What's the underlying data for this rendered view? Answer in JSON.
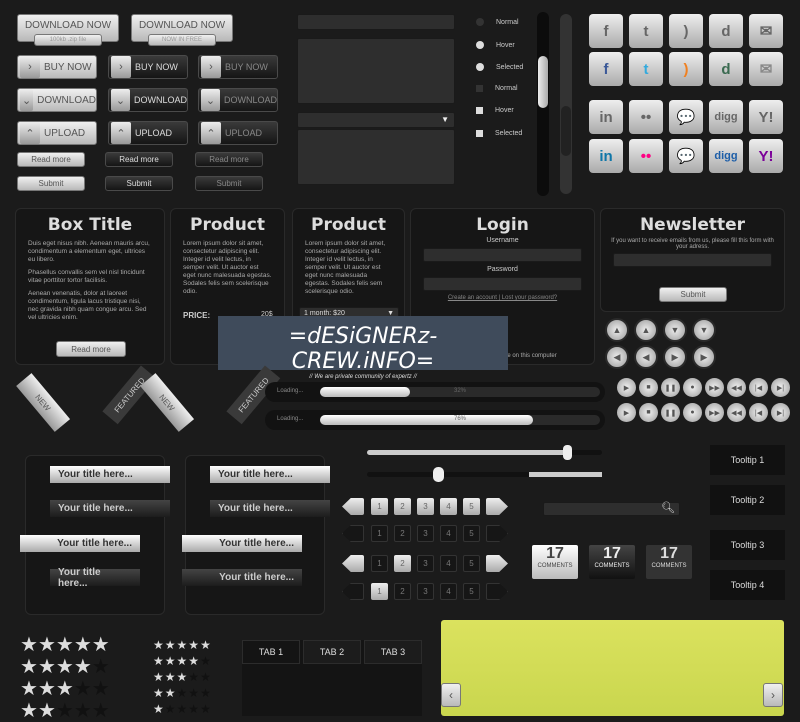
{
  "download_buttons": [
    {
      "label": "DOWNLOAD NOW",
      "sub": "100kb .zip file"
    },
    {
      "label": "DOWNLOAD NOW",
      "sub": "NOW IN FREE"
    }
  ],
  "action_buttons": [
    "BUY NOW",
    "DOWNLOAD",
    "UPLOAD"
  ],
  "small_buttons": [
    "Read more",
    "Submit"
  ],
  "radio_states": [
    "Normal",
    "Hover",
    "Selected"
  ],
  "checkbox_states": [
    "Normal",
    "Hover",
    "Selected"
  ],
  "social_icons": [
    "facebook",
    "twitter",
    "rss",
    "deviantart",
    "email",
    "linkedin",
    "flickr",
    "chat",
    "digg",
    "yahoo"
  ],
  "social_glyphs": [
    "f",
    "t",
    ")",
    "d",
    "✉",
    "in",
    "••",
    "💬",
    "digg",
    "Y!"
  ],
  "box": {
    "title": "Box Title",
    "paragraphs": [
      "Duis eget nisus nibh. Aenean mauris arcu, condimentum a elementum eget, ultrices eu libero.",
      "Phasellus convallis sem vel nisl tincidunt vitae porttitor tortor facilisis.",
      "Aenean venenatis, dolor at laoreet condimentum, ligula lacus tristique nisi, nec gravida nibh quam congue arcu. Sed vel ultricies enim."
    ],
    "button": "Read more"
  },
  "product1": {
    "title": "Product",
    "text": "Lorem ipsum dolor sit amet, consectetur adipiscing elit. Integer id velit lectus, in semper velit. Ut auctor est eget nunc malesuada egestas. Sodales felis sem scelerisque odio.",
    "price_label": "PRICE:",
    "price": "20$"
  },
  "product2": {
    "title": "Product",
    "text": "Lorem ipsum dolor sit amet, consectetur adipiscing elit. Integer id velit lectus, in semper velit. Ut auctor est eget nunc malesuada egestas. Sodales felis sem scelerisque odio.",
    "select": "1 month: $20"
  },
  "login": {
    "title": "Login",
    "username": "Username",
    "password": "Password",
    "links": "Create an account | Lost your password?",
    "remember": "Remember me on this computer"
  },
  "newsletter": {
    "title": "Newsletter",
    "text": "If you want to receive emails from us, please fill this form with your adress.",
    "button": "Submit"
  },
  "watermark": {
    "title": "=dESiGNERz-CREW.iNFO=",
    "sub": "// We are private community of expertz //"
  },
  "ribbons": [
    "NEW",
    "FEATURED",
    "NEW",
    "FEATURED"
  ],
  "progress": [
    {
      "label": "Loading...",
      "value": 32,
      "text": "32%"
    },
    {
      "label": "Loading...",
      "value": 76,
      "text": "76%"
    }
  ],
  "sliders": [
    85,
    30
  ],
  "title_label": "Your title here...",
  "pagination": {
    "pages": [
      "1",
      "2",
      "3",
      "4",
      "5"
    ]
  },
  "comments": {
    "count": "17",
    "label": "COMMENTS"
  },
  "tooltips": [
    "Tooltip 1",
    "Tooltip 2",
    "Tooltip 3",
    "Tooltip 4"
  ],
  "ratings": [
    5,
    4,
    3,
    2
  ],
  "small_ratings": [
    5,
    4,
    3,
    2,
    1
  ],
  "tabs": [
    "TAB 1",
    "TAB 2",
    "TAB 3"
  ],
  "colors": {
    "panel": "#d4de5a",
    "background": "#1b1b1b"
  }
}
